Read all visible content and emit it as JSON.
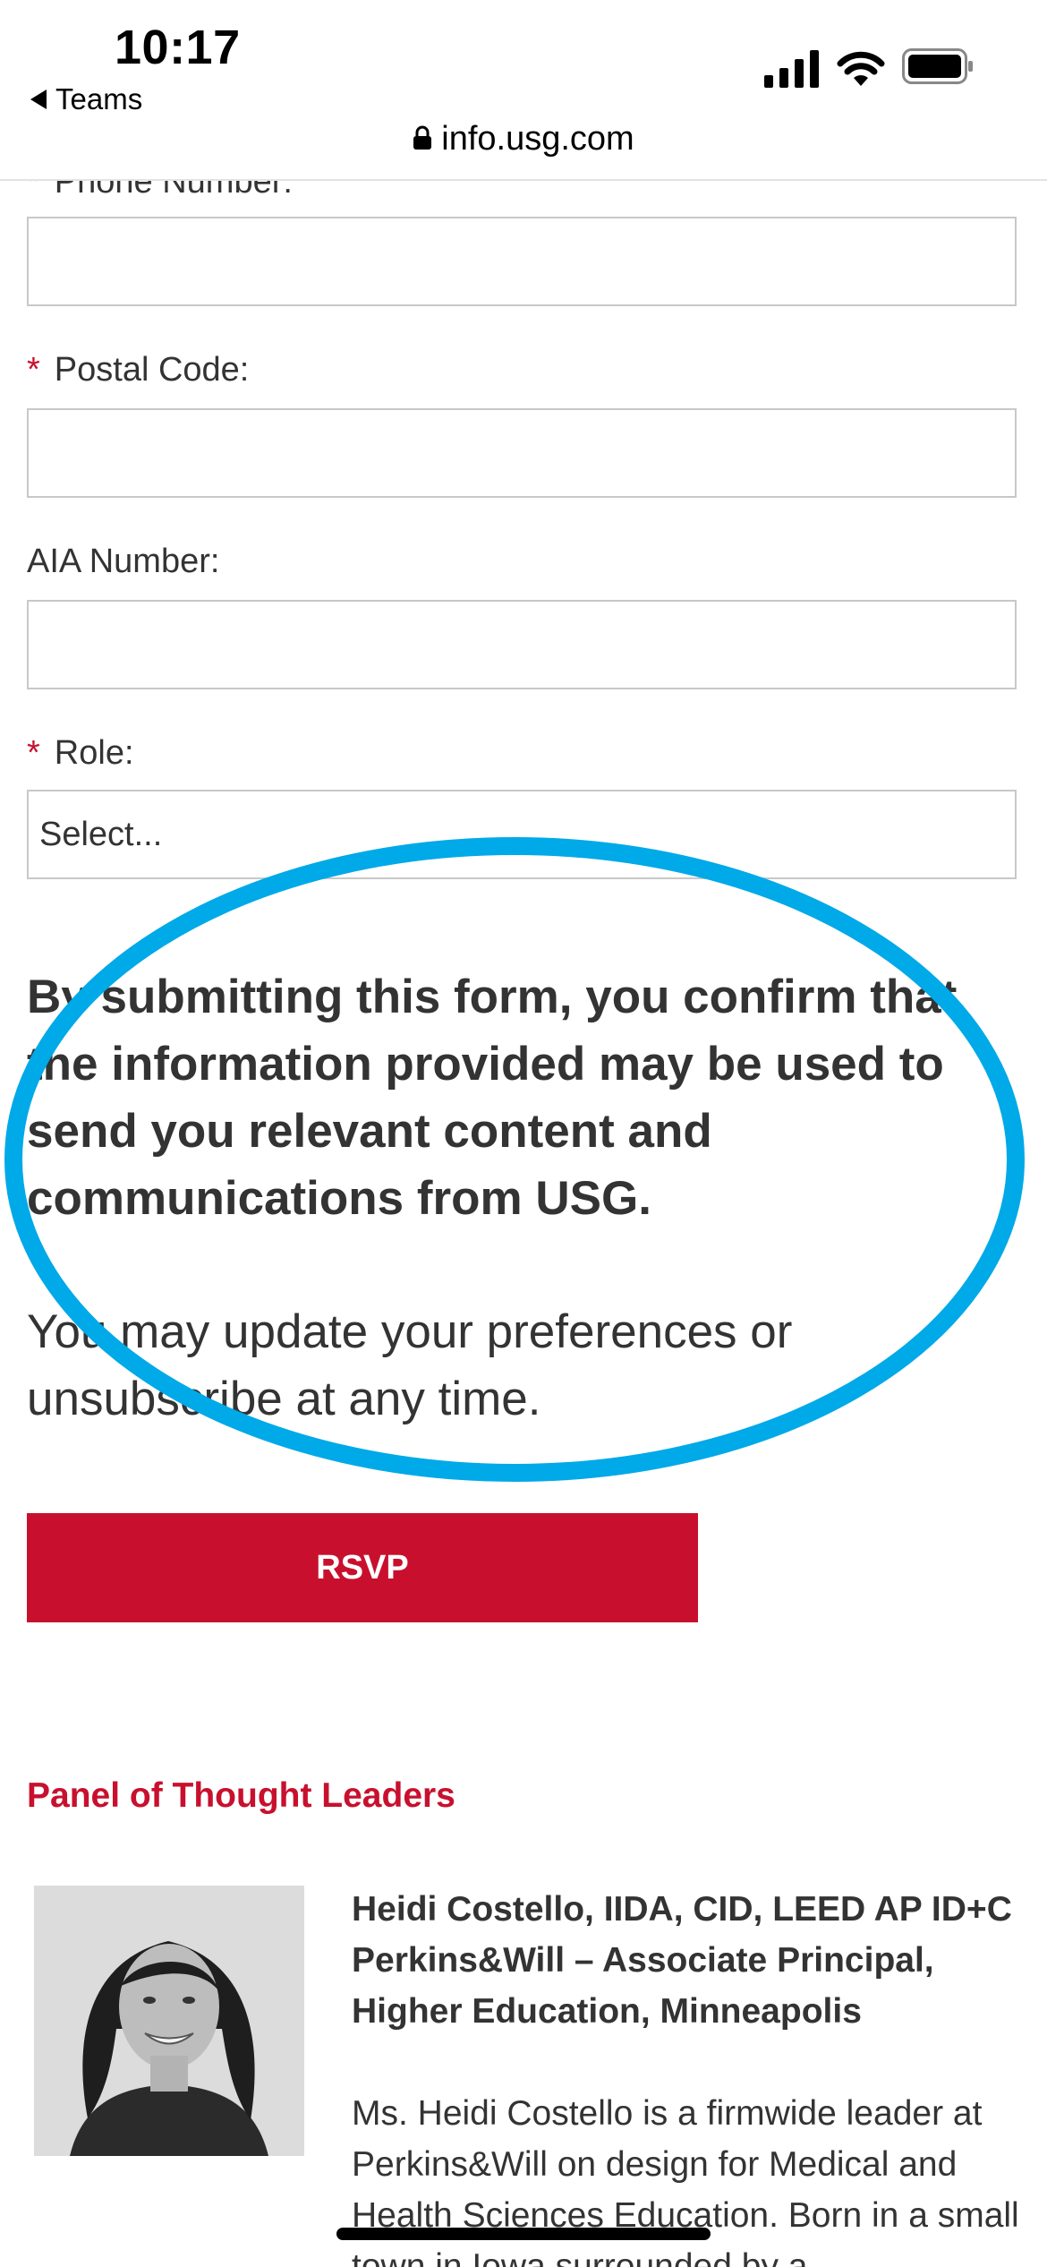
{
  "status_bar": {
    "time": "10:17",
    "back_app": "Teams",
    "url": "info.usg.com",
    "icons": [
      "cellular-signal-icon",
      "wifi-icon",
      "battery-icon",
      "back-arrow-icon",
      "lock-icon"
    ]
  },
  "form": {
    "phone_label": "Phone Number:",
    "postal_label": "Postal Code:",
    "aia_label": "AIA Number:",
    "role_label": "Role:",
    "required_marker": "*",
    "role_value": "Select...",
    "phone_value": "",
    "postal_value": "",
    "aia_value": ""
  },
  "disclaimer": "By submitting this form, you confirm that the information provided may be used to send you relevant content and communications from USG.",
  "preferences_note": "You may update your preferences or unsubscribe at any time.",
  "rsvp_label": "RSVP",
  "panel": {
    "title": "Panel of Thought Leaders",
    "speaker_heading": "Heidi Costello, IIDA, CID, LEED AP ID+C  Perkins&Will – Associate Principal, Higher Education, Minneapolis",
    "speaker_bio": "Ms. Heidi Costello is a firmwide leader at Perkins&Will on design for Medical and Health Sciences Education. Born in a small town in Iowa surrounded by a"
  },
  "colors": {
    "brand_red": "#c8102e",
    "highlight_blue": "#00a9e8",
    "text": "#333333",
    "field_border": "#c8c8c8"
  }
}
